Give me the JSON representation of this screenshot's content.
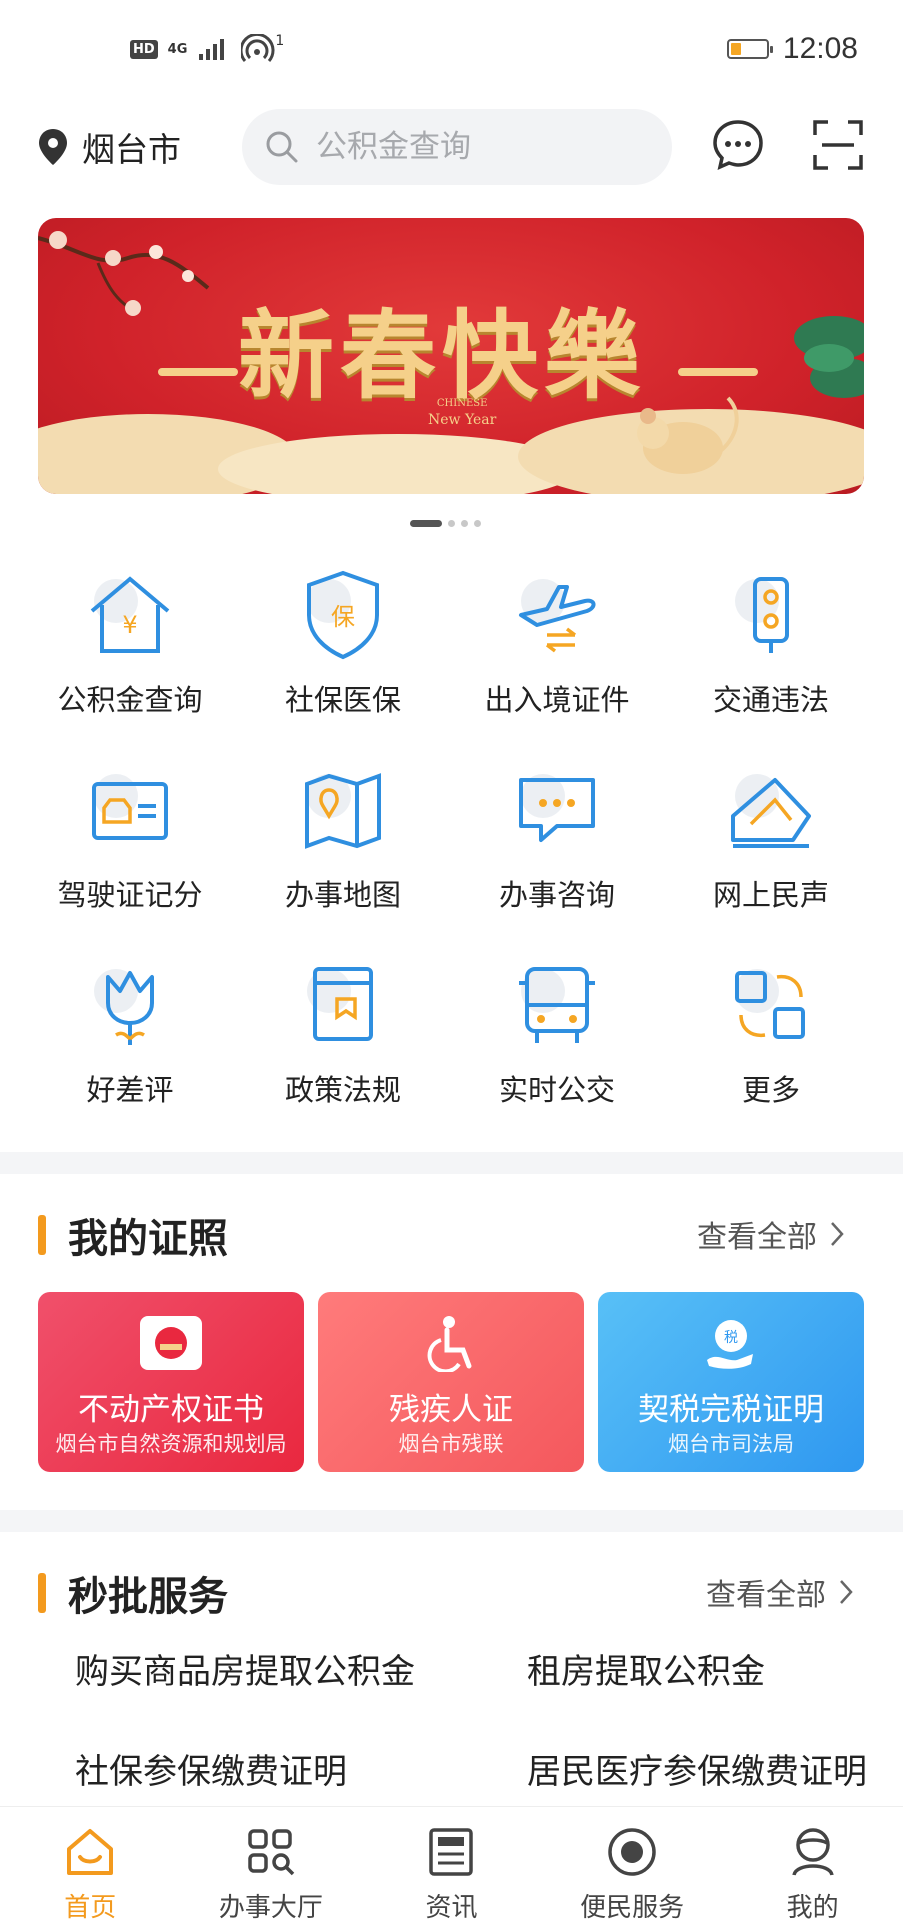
{
  "status_bar": {
    "hd": "HD",
    "network": "4G",
    "hotspot_count": "1",
    "time": "12:08",
    "battery_level": 0.3
  },
  "header": {
    "city": "烟台市",
    "search_placeholder": "公积金查询"
  },
  "banner": {
    "headline": "新春快樂",
    "sub_line1": "CHINESE",
    "sub_line2": "New Year",
    "page_count": 4,
    "active_page": 0
  },
  "services": [
    {
      "label": "公积金查询",
      "icon": "house-yen-icon"
    },
    {
      "label": "社保医保",
      "icon": "shield-bao-icon"
    },
    {
      "label": "出入境证件",
      "icon": "airplane-icon"
    },
    {
      "label": "交通违法",
      "icon": "traffic-light-icon"
    },
    {
      "label": "驾驶证记分",
      "icon": "license-card-icon"
    },
    {
      "label": "办事地图",
      "icon": "map-pin-icon"
    },
    {
      "label": "办事咨询",
      "icon": "chat-bubble-icon"
    },
    {
      "label": "网上民声",
      "icon": "envelope-icon"
    },
    {
      "label": "好差评",
      "icon": "flower-icon"
    },
    {
      "label": "政策法规",
      "icon": "book-icon"
    },
    {
      "label": "实时公交",
      "icon": "bus-icon"
    },
    {
      "label": "更多",
      "icon": "more-grid-icon"
    }
  ],
  "certificates": {
    "title": "我的证照",
    "more": "查看全部",
    "cards": [
      {
        "title": "不动产权证书",
        "sub": "烟台市自然资源和规划局",
        "color1": "#f0506b",
        "color2": "#e9283f"
      },
      {
        "title": "残疾人证",
        "sub": "烟台市残联",
        "color1": "#ff7b7b",
        "color2": "#f4585d"
      },
      {
        "title": "契税完税证明",
        "sub": "烟台市司法局",
        "color1": "#58c0f7",
        "color2": "#2f98f0"
      }
    ]
  },
  "quick_approval": {
    "title": "秒批服务",
    "more": "查看全部",
    "items": [
      "购买商品房提取公积金",
      "租房提取公积金",
      "社保参保缴费证明",
      "居民医疗参保缴费证明"
    ]
  },
  "tabbar": {
    "items": [
      {
        "label": "首页",
        "icon": "home-icon"
      },
      {
        "label": "办事大厅",
        "icon": "grid-search-icon"
      },
      {
        "label": "资讯",
        "icon": "news-icon"
      },
      {
        "label": "便民服务",
        "icon": "target-icon"
      },
      {
        "label": "我的",
        "icon": "profile-icon"
      }
    ]
  },
  "colors": {
    "accent": "#f39a1e",
    "icon_blue": "#2f8fe0",
    "icon_orange": "#f5a623"
  }
}
